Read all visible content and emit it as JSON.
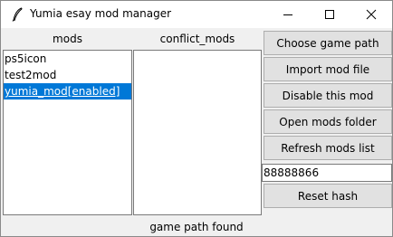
{
  "window": {
    "title": "Yumia esay mod manager"
  },
  "labels": {
    "mods": "mods",
    "conflict_mods": "conflict_mods"
  },
  "mods_list": [
    {
      "label": "ps5icon",
      "selected": false
    },
    {
      "label": "test2mod",
      "selected": false
    },
    {
      "label": "yumia_mod[enabled]",
      "selected": true
    }
  ],
  "conflict_mods_list": [],
  "buttons": {
    "choose_game_path": "Choose game path",
    "import_mod_file": "Import mod file",
    "disable_this_mod": "Disable this mod",
    "open_mods_folder": "Open mods folder",
    "refresh_mods_list": "Refresh mods list",
    "reset_hash": "Reset hash"
  },
  "hash_input": {
    "value": "88888866"
  },
  "status": "game path found",
  "colors": {
    "selection": "#0078d7",
    "button_face": "#e1e1e1"
  }
}
